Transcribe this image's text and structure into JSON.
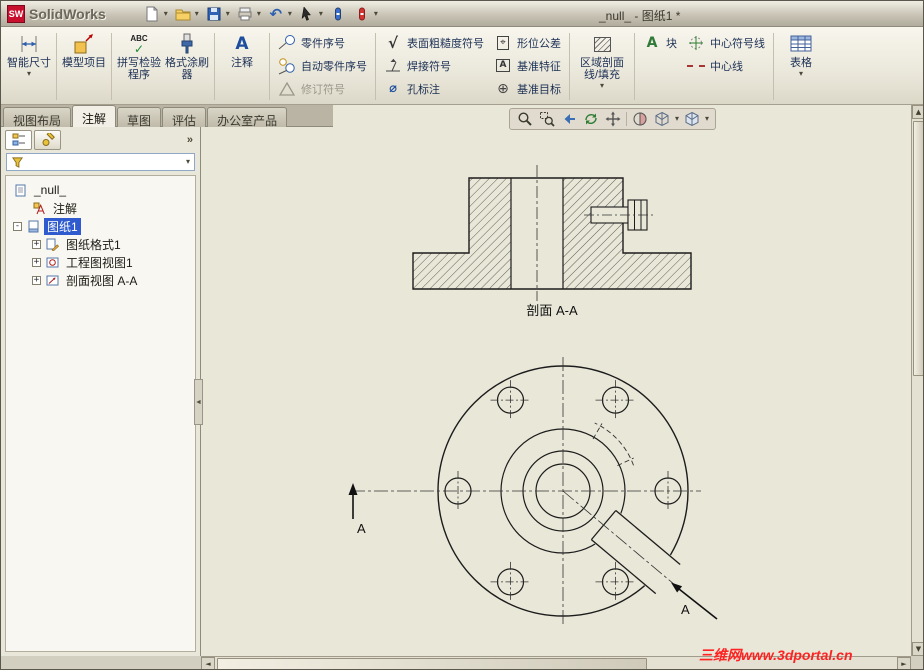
{
  "window": {
    "logo_badge": "SW",
    "app_name": "SolidWorks",
    "doc_title": "_null_ - 图纸1 *"
  },
  "ribbon": {
    "smart_dimension": "智能尺寸",
    "model_items": "模型项目",
    "spell_checker": "拼写检验程序",
    "format_painter": "格式涂刷器",
    "note": "注释",
    "balloon": "零件序号",
    "auto_balloon": "自动零件序号",
    "revision_symbol": "修订符号",
    "surface_finish": "表面粗糙度符号",
    "weld_symbol": "焊接符号",
    "hole_callout": "孔标注",
    "geo_tolerance": "形位公差",
    "datum_feature": "基准特征",
    "datum_target": "基准目标",
    "area_hatch": "区域剖面线/填充",
    "block": "块",
    "center_mark": "中心符号线",
    "centerline": "中心线",
    "table": "表格",
    "spell_icon_text": "ABC"
  },
  "tabs": {
    "view_layout": "视图布局",
    "annotation": "注解",
    "sketch": "草图",
    "evaluate": "评估",
    "office_products": "办公室产品"
  },
  "tree": {
    "root": "_null_",
    "annotations": "注解",
    "sheet1": "图纸1",
    "sheet_format": "图纸格式1",
    "drawing_view": "工程图视图1",
    "section_view": "剖面视图 A-A"
  },
  "drawing": {
    "section_caption": "剖面 A-A",
    "arrow_left_label": "A",
    "arrow_right_label": "A"
  },
  "watermark": {
    "text": "三维网www.3dportal.cn",
    "color": "#ff2222"
  },
  "icons": {
    "caret": "▾",
    "check": "✓",
    "position_symbol": "⌖",
    "datum_target_symbol": "⊕",
    "diameter_symbol": "⌀",
    "undo_arrow": "↶"
  },
  "colors": {
    "selection_blue": "#2f5bce",
    "viewport_beige": "#e9e7d8",
    "watermark_red": "#ff2222"
  }
}
